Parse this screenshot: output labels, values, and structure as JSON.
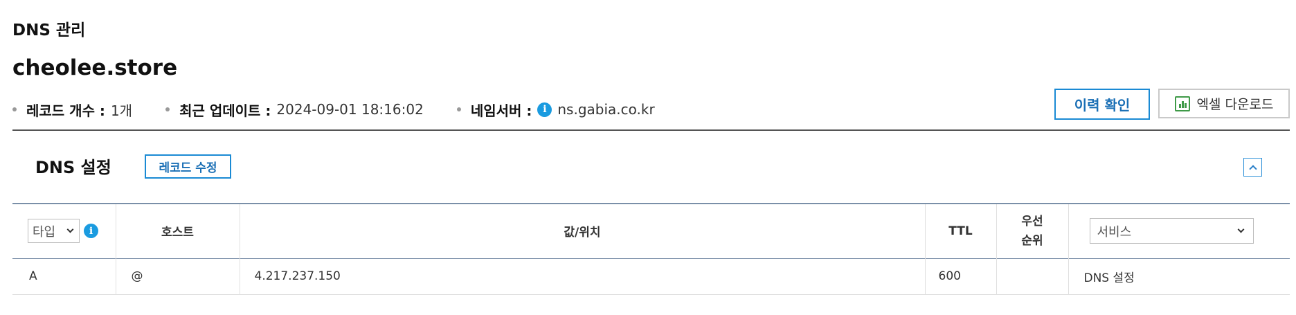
{
  "page": {
    "label": "DNS 관리"
  },
  "domain": {
    "name": "cheolee.store"
  },
  "summary": {
    "record_count_key": "레코드 개수 :",
    "record_count_val": "1개",
    "updated_key": "최근 업데이트 :",
    "updated_val": "2024-09-01 18:16:02",
    "nameserver_key": "네임서버 :",
    "nameserver_val": "ns.gabia.co.kr",
    "info_glyph": "i"
  },
  "actions": {
    "history_label": "이력 확인",
    "excel_label": "엑셀 다운로드"
  },
  "dns_section": {
    "title": "DNS 설정",
    "edit_label": "레코드 수정"
  },
  "table": {
    "type_filter_value": "타입",
    "info_glyph": "i",
    "headers": {
      "host": "호스트",
      "value": "값/위치",
      "ttl": "TTL",
      "priority_line1": "우선",
      "priority_line2": "순위"
    },
    "service_filter_value": "서비스",
    "rows": [
      {
        "type": "A",
        "host": "@",
        "value": "4.217.237.150",
        "ttl": "600",
        "priority": "",
        "service": "DNS 설정"
      }
    ]
  },
  "colors": {
    "accent_blue": "#1a8ad4",
    "info_blue": "#1a9be0",
    "excel_green": "#3f9a48"
  }
}
